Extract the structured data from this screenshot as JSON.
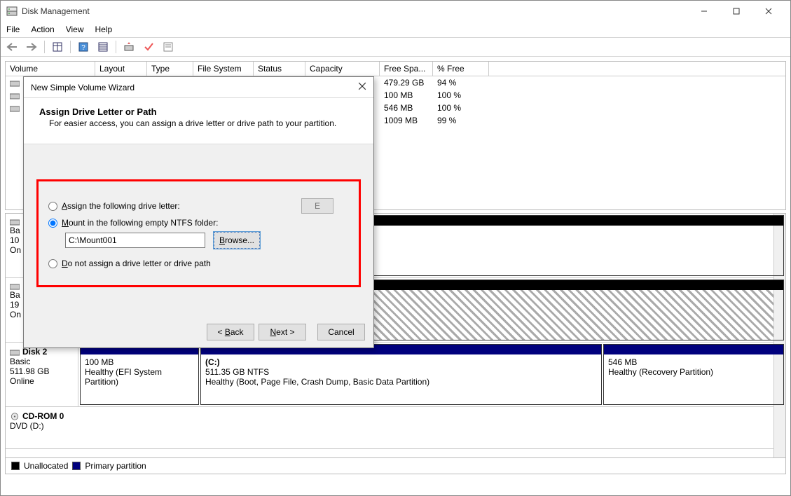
{
  "window": {
    "title": "Disk Management"
  },
  "menu": {
    "file": "File",
    "action": "Action",
    "view": "View",
    "help": "Help"
  },
  "columns": {
    "volume": "Volume",
    "layout": "Layout",
    "type": "Type",
    "fs": "File System",
    "status": "Status",
    "capacity": "Capacity",
    "free": "Free Spa...",
    "pct": "% Free"
  },
  "rows": [
    {
      "free": "479.29 GB",
      "pct": "94 %"
    },
    {
      "free": "100 MB",
      "pct": "100 %"
    },
    {
      "free": "546 MB",
      "pct": "100 %"
    },
    {
      "free": "1009 MB",
      "pct": "99 %"
    }
  ],
  "disk2": {
    "name": "Disk 2",
    "type": "Basic",
    "size": "511.98 GB",
    "status": "Online",
    "p1": {
      "size": "100 MB",
      "status": "Healthy (EFI System Partition)"
    },
    "p2": {
      "label": "(C:)",
      "size": "511.35 GB NTFS",
      "status": "Healthy (Boot, Page File, Crash Dump, Basic Data Partition)"
    },
    "p3": {
      "size": "546 MB",
      "status": "Healthy (Recovery Partition)"
    }
  },
  "cdrom": {
    "name": "CD-ROM 0",
    "sub": "DVD (D:)"
  },
  "diskA": {
    "type": "Ba",
    "size": "10",
    "status": "On"
  },
  "diskB": {
    "type": "Ba",
    "size": "19",
    "status": "On"
  },
  "legend": {
    "unalloc": "Unallocated",
    "primary": "Primary partition"
  },
  "wizard": {
    "title": "New Simple Volume Wizard",
    "heading": "Assign Drive Letter or Path",
    "sub": "For easier access, you can assign a drive letter or drive path to your partition.",
    "opt1_full": "Assign the following drive letter:",
    "opt1_u": "A",
    "opt1_rest": "ssign the following drive letter:",
    "drive": "E",
    "opt2_u": "M",
    "opt2_rest": "ount in the following empty NTFS folder:",
    "path": "C:\\Mount001",
    "browse_u": "B",
    "browse_rest": "rowse...",
    "opt3_u": "D",
    "opt3_rest": "o not assign a drive letter or drive path",
    "back_lt": "< ",
    "back_u": "B",
    "back_rest": "ack",
    "next_u": "N",
    "next_rest": "ext >",
    "cancel": "Cancel"
  }
}
